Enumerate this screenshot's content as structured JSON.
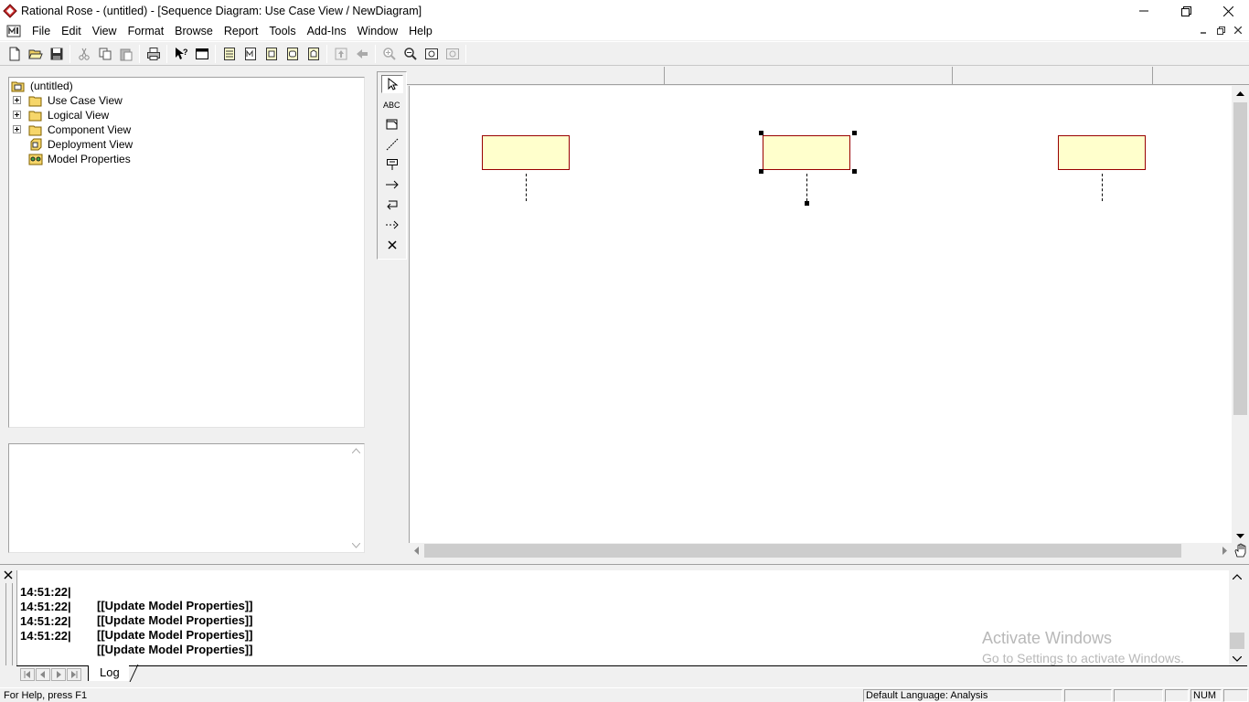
{
  "window": {
    "title": "Rational Rose - (untitled) - [Sequence Diagram: Use Case View / NewDiagram]"
  },
  "menu": {
    "items": [
      "File",
      "Edit",
      "View",
      "Format",
      "Browse",
      "Report",
      "Tools",
      "Add-Ins",
      "Window",
      "Help"
    ]
  },
  "browser": {
    "root": "(untitled)",
    "items": [
      {
        "label": "Use Case View",
        "icon": "folder-icon",
        "expandable": true
      },
      {
        "label": "Logical View",
        "icon": "folder-icon",
        "expandable": true
      },
      {
        "label": "Component View",
        "icon": "folder-icon",
        "expandable": true
      },
      {
        "label": "Deployment View",
        "icon": "deployment-icon",
        "expandable": false
      },
      {
        "label": "Model Properties",
        "icon": "properties-icon",
        "expandable": false
      }
    ]
  },
  "toolbox": {
    "tools": [
      "selection-arrow-icon",
      "text-box-icon",
      "note-icon",
      "anchor-line-icon",
      "object-icon",
      "object-message-icon",
      "message-to-self-icon",
      "return-message-icon",
      "destruction-marker-icon"
    ]
  },
  "diagram": {
    "object_fill": "#ffffcc",
    "object_border": "#990000"
  },
  "log": {
    "entries": [
      {
        "time": "14:51:22|",
        "message": "[[Update Model Properties]]"
      },
      {
        "time": "14:51:22|",
        "message": "[[Update Model Properties]]"
      },
      {
        "time": "14:51:22|",
        "message": "[[Update Model Properties]]"
      },
      {
        "time": "14:51:22|",
        "message": "[[Update Model Properties]]"
      }
    ],
    "tab_label": "Log"
  },
  "watermark": {
    "line1": "Activate Windows",
    "line2": "Go to Settings to activate Windows."
  },
  "statusbar": {
    "help": "For Help, press F1",
    "language": "Default Language: Analysis",
    "num": "NUM"
  }
}
